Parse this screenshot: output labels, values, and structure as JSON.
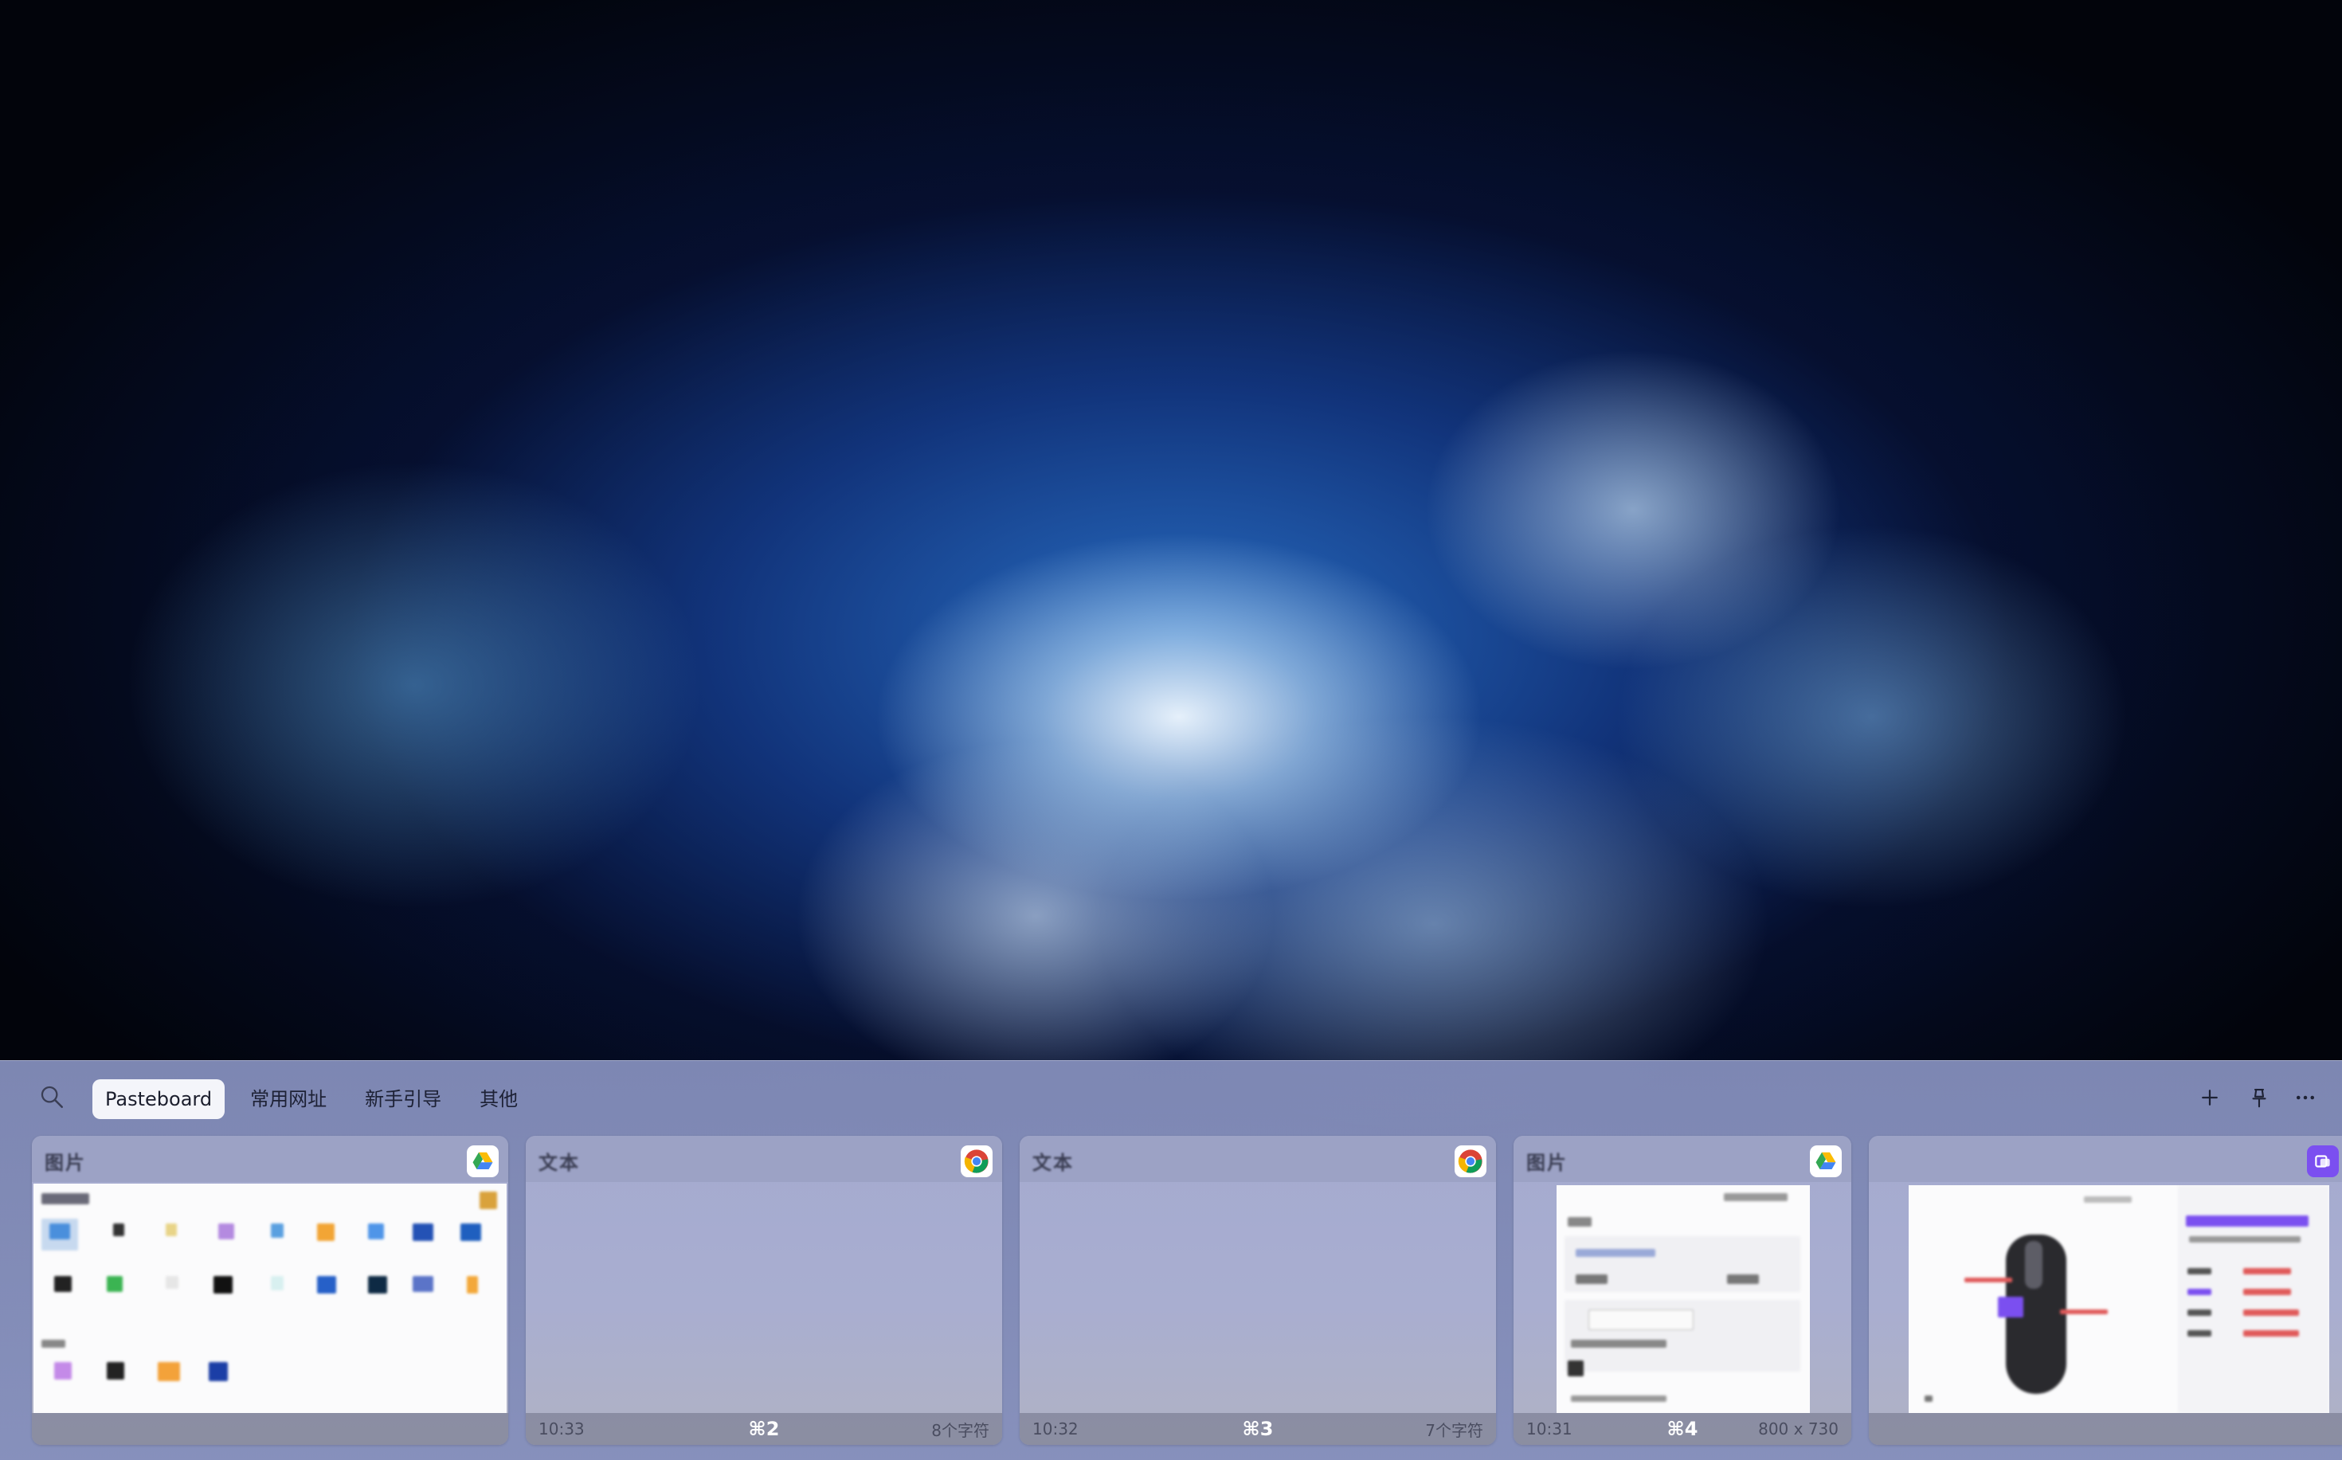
{
  "toolbar": {
    "search_icon": "search-icon",
    "tabs": [
      {
        "label": "Pasteboard",
        "active": true
      },
      {
        "label": "常用网址",
        "active": false
      },
      {
        "label": "新手引导",
        "active": false
      },
      {
        "label": "其他",
        "active": false
      }
    ],
    "actions": [
      "plus-icon",
      "pin-icon",
      "more-icon"
    ]
  },
  "cards": [
    {
      "type_label": "图片",
      "app_icon": "google-drive-icon",
      "time": "",
      "shortcut": "",
      "meta": ""
    },
    {
      "type_label": "文本",
      "app_icon": "chrome-icon",
      "preview_text": "",
      "time": "10:33",
      "shortcut": "⌘2",
      "meta": "8个字符"
    },
    {
      "type_label": "文本",
      "app_icon": "chrome-icon",
      "preview_text": "",
      "time": "10:32",
      "shortcut": "⌘3",
      "meta": "7个字符"
    },
    {
      "type_label": "图片",
      "app_icon": "google-drive-icon",
      "time": "10:31",
      "shortcut": "⌘4",
      "meta": "800 x 730"
    },
    {
      "type_label": "",
      "app_icon": "screenshot-app-icon",
      "time": "",
      "shortcut": "",
      "meta": ""
    }
  ],
  "colors": {
    "panel": "#8c96c3",
    "active_tab": "#f4f5fa",
    "shortcut_text": "#ffffff",
    "accent_purple": "#7b4ff0"
  }
}
